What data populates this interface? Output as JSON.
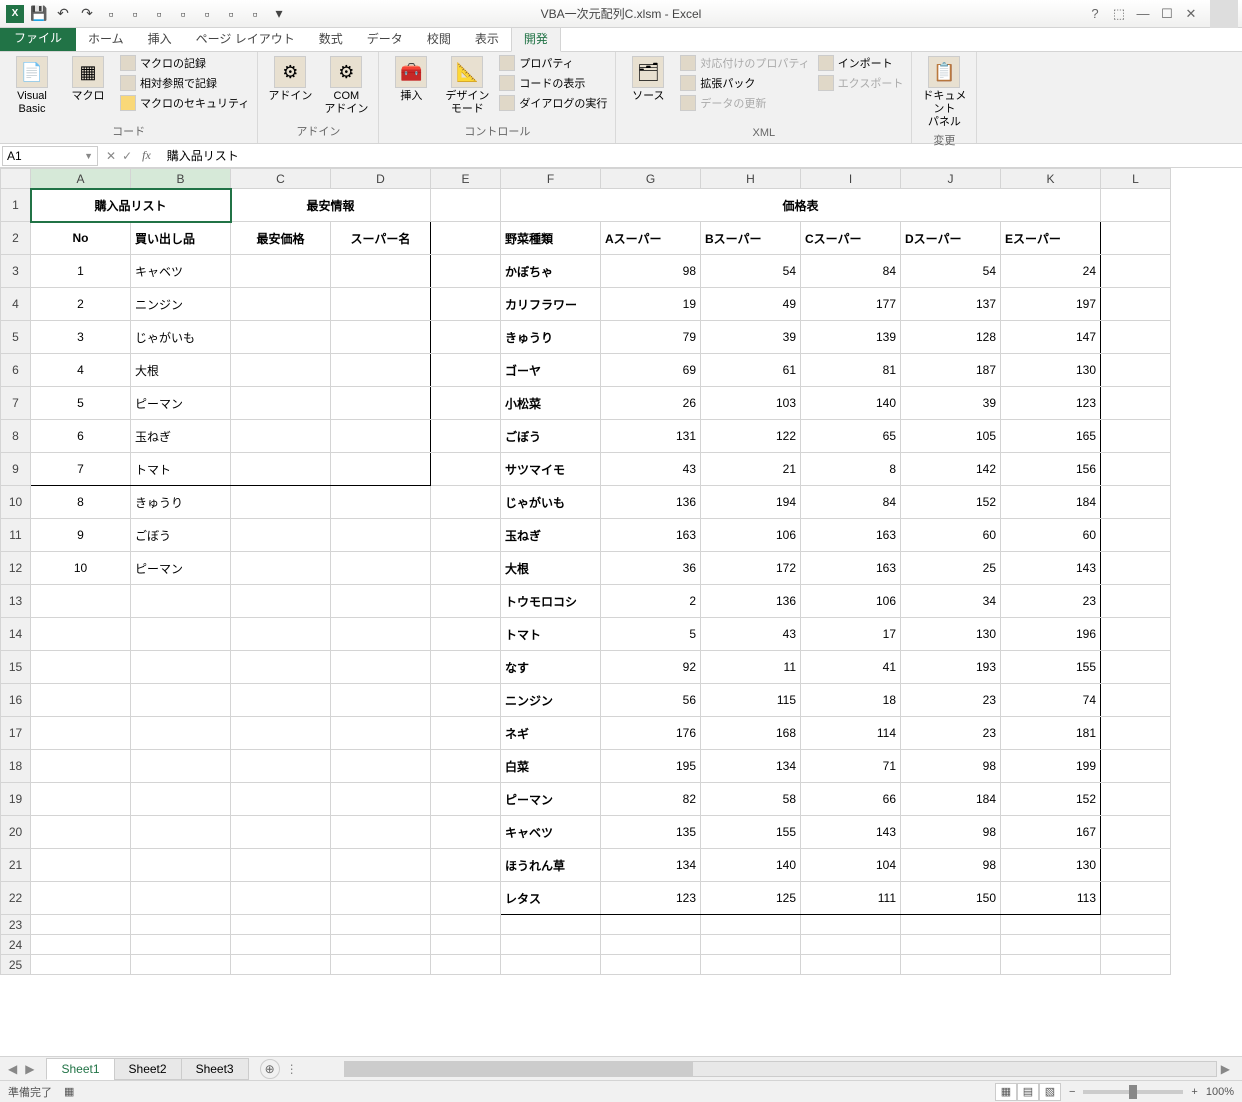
{
  "window": {
    "title": "VBA一次元配列C.xlsm - Excel"
  },
  "tabs": {
    "file": "ファイル",
    "home": "ホーム",
    "insert": "挿入",
    "pageLayout": "ページ レイアウト",
    "formulas": "数式",
    "data": "データ",
    "review": "校閲",
    "view": "表示",
    "developer": "開発"
  },
  "ribbon": {
    "code": {
      "label": "コード",
      "visualBasic": "Visual Basic",
      "macros": "マクロ",
      "recordMacro": "マクロの記録",
      "useRelativeRef": "相対参照で記録",
      "macroSecurity": "マクロのセキュリティ"
    },
    "addins": {
      "label": "アドイン",
      "addins": "アドイン",
      "comAddins": "COM\nアドイン"
    },
    "controls": {
      "label": "コントロール",
      "insert": "挿入",
      "designMode": "デザイン\nモード",
      "properties": "プロパティ",
      "viewCode": "コードの表示",
      "runDialog": "ダイアログの実行"
    },
    "xml": {
      "label": "XML",
      "source": "ソース",
      "mapProperties": "対応付けのプロパティ",
      "expansionPacks": "拡張パック",
      "refreshData": "データの更新",
      "import": "インポート",
      "export": "エクスポート"
    },
    "modify": {
      "label": "変更",
      "documentPanel": "ドキュメント\nパネル"
    }
  },
  "formulaBar": {
    "nameBox": "A1",
    "formula": "購入品リスト"
  },
  "columns": [
    "A",
    "B",
    "C",
    "D",
    "E",
    "F",
    "G",
    "H",
    "I",
    "J",
    "K",
    "L"
  ],
  "rowCount": 25,
  "sheet": {
    "purchaseList": {
      "title": "購入品リスト",
      "headers": {
        "no": "No",
        "item": "買い出し品"
      },
      "rows": [
        {
          "no": "1",
          "item": "キャベツ"
        },
        {
          "no": "2",
          "item": "ニンジン"
        },
        {
          "no": "3",
          "item": "じゃがいも"
        },
        {
          "no": "4",
          "item": "大根"
        },
        {
          "no": "5",
          "item": "ピーマン"
        },
        {
          "no": "6",
          "item": "玉ねぎ"
        },
        {
          "no": "7",
          "item": "トマト"
        },
        {
          "no": "8",
          "item": "きゅうり"
        },
        {
          "no": "9",
          "item": "ごぼう"
        },
        {
          "no": "10",
          "item": "ピーマン"
        }
      ]
    },
    "cheapest": {
      "title": "最安情報",
      "headers": {
        "price": "最安価格",
        "store": "スーパー名"
      }
    },
    "priceTable": {
      "title": "価格表",
      "headers": {
        "veg": "野菜種類",
        "a": "Aスーパー",
        "b": "Bスーパー",
        "c": "Cスーパー",
        "d": "Dスーパー",
        "e": "Eスーパー"
      },
      "rows": [
        {
          "veg": "かぼちゃ",
          "a": 98,
          "b": 54,
          "c": 84,
          "d": 54,
          "e": 24
        },
        {
          "veg": "カリフラワー",
          "a": 19,
          "b": 49,
          "c": 177,
          "d": 137,
          "e": 197
        },
        {
          "veg": "きゅうり",
          "a": 79,
          "b": 39,
          "c": 139,
          "d": 128,
          "e": 147
        },
        {
          "veg": "ゴーヤ",
          "a": 69,
          "b": 61,
          "c": 81,
          "d": 187,
          "e": 130
        },
        {
          "veg": "小松菜",
          "a": 26,
          "b": 103,
          "c": 140,
          "d": 39,
          "e": 123
        },
        {
          "veg": "ごぼう",
          "a": 131,
          "b": 122,
          "c": 65,
          "d": 105,
          "e": 165
        },
        {
          "veg": "サツマイモ",
          "a": 43,
          "b": 21,
          "c": 8,
          "d": 142,
          "e": 156
        },
        {
          "veg": "じゃがいも",
          "a": 136,
          "b": 194,
          "c": 84,
          "d": 152,
          "e": 184
        },
        {
          "veg": "玉ねぎ",
          "a": 163,
          "b": 106,
          "c": 163,
          "d": 60,
          "e": 60
        },
        {
          "veg": "大根",
          "a": 36,
          "b": 172,
          "c": 163,
          "d": 25,
          "e": 143
        },
        {
          "veg": "トウモロコシ",
          "a": 2,
          "b": 136,
          "c": 106,
          "d": 34,
          "e": 23
        },
        {
          "veg": "トマト",
          "a": 5,
          "b": 43,
          "c": 17,
          "d": 130,
          "e": 196
        },
        {
          "veg": "なす",
          "a": 92,
          "b": 11,
          "c": 41,
          "d": 193,
          "e": 155
        },
        {
          "veg": "ニンジン",
          "a": 56,
          "b": 115,
          "c": 18,
          "d": 23,
          "e": 74
        },
        {
          "veg": "ネギ",
          "a": 176,
          "b": 168,
          "c": 114,
          "d": 23,
          "e": 181
        },
        {
          "veg": "白菜",
          "a": 195,
          "b": 134,
          "c": 71,
          "d": 98,
          "e": 199
        },
        {
          "veg": "ピーマン",
          "a": 82,
          "b": 58,
          "c": 66,
          "d": 184,
          "e": 152
        },
        {
          "veg": "キャベツ",
          "a": 135,
          "b": 155,
          "c": 143,
          "d": 98,
          "e": 167
        },
        {
          "veg": "ほうれん草",
          "a": 134,
          "b": 140,
          "c": 104,
          "d": 98,
          "e": 130
        },
        {
          "veg": "レタス",
          "a": 123,
          "b": 125,
          "c": 111,
          "d": 150,
          "e": 113
        }
      ]
    }
  },
  "sheetTabs": [
    "Sheet1",
    "Sheet2",
    "Sheet3"
  ],
  "activeSheet": "Sheet1",
  "status": {
    "ready": "準備完了",
    "zoom": "100%"
  },
  "colWidths": {
    "row": 30,
    "A": 100,
    "B": 100,
    "C": 100,
    "D": 100,
    "E": 70,
    "F": 100,
    "G": 100,
    "H": 100,
    "I": 100,
    "J": 100,
    "K": 100,
    "L": 70
  }
}
